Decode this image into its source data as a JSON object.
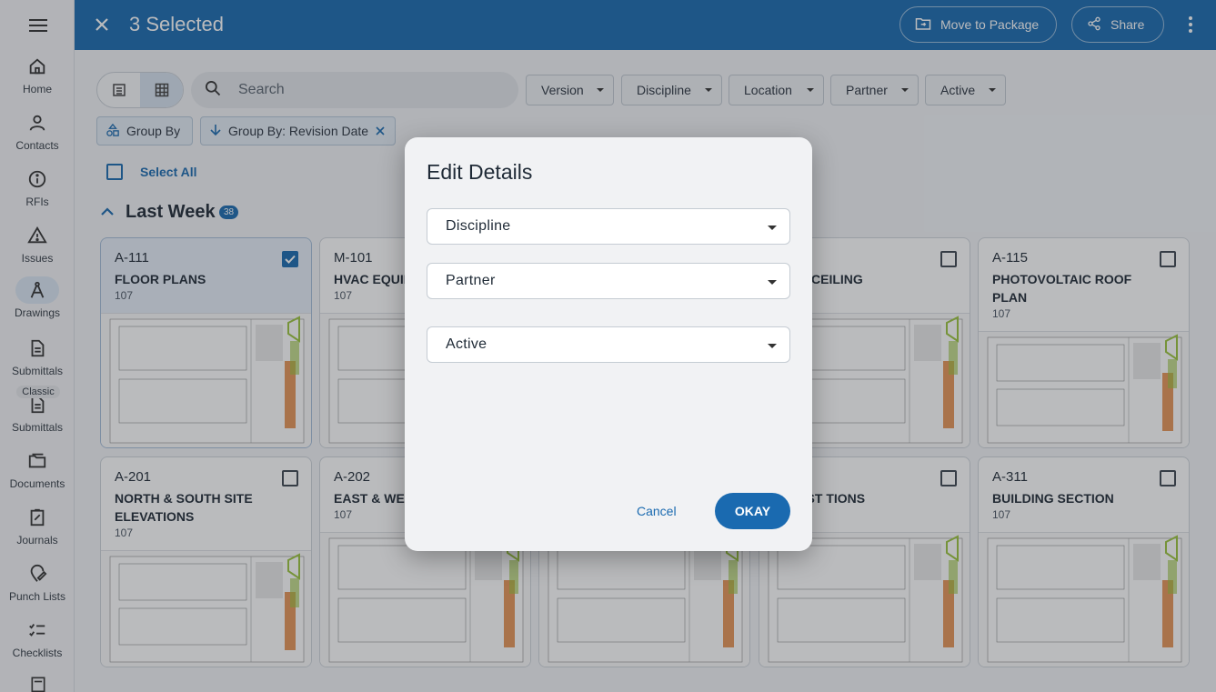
{
  "sidebar": {
    "items": [
      {
        "label": "Home",
        "icon": "home-icon"
      },
      {
        "label": "Contacts",
        "icon": "person-icon"
      },
      {
        "label": "RFIs",
        "icon": "info-icon"
      },
      {
        "label": "Issues",
        "icon": "warning-icon"
      },
      {
        "label": "Drawings",
        "icon": "compass-icon"
      },
      {
        "label": "Submittals",
        "icon": "document-icon"
      },
      {
        "label": "Submittals",
        "icon": "document-icon"
      },
      {
        "label": "Documents",
        "icon": "folder-icon"
      },
      {
        "label": "Journals",
        "icon": "edit-note-icon"
      },
      {
        "label": "Punch Lists",
        "icon": "pin-edit-icon"
      },
      {
        "label": "Checklists",
        "icon": "checklist-icon"
      }
    ],
    "classic_badge": "Classic"
  },
  "header": {
    "title": "3 Selected",
    "move_label": "Move to Package",
    "share_label": "Share"
  },
  "toolbar": {
    "search_placeholder": "Search",
    "filters": [
      "Version",
      "Discipline",
      "Location",
      "Partner",
      "Active"
    ],
    "group_by": "Group By",
    "group_by_chip": "Group By: Revision Date",
    "select_all": "Select All"
  },
  "group": {
    "title": "Last Week",
    "count": "38"
  },
  "cards": [
    {
      "number": "A-111",
      "name": "FLOOR PLANS",
      "rev": "107",
      "selected": true
    },
    {
      "number": "M-101",
      "name": "HVAC EQUIP",
      "rev": "107",
      "selected": false
    },
    {
      "number": "",
      "name": "",
      "rev": "",
      "selected": false
    },
    {
      "number": "",
      "name": "CTED CEILING",
      "rev": "",
      "selected": false
    },
    {
      "number": "A-115",
      "name": "PHOTOVOLTAIC ROOF PLAN",
      "rev": "107",
      "selected": false
    },
    {
      "number": "A-201",
      "name": "NORTH & SOUTH SITE ELEVATIONS",
      "rev": "107",
      "selected": false
    },
    {
      "number": "A-202",
      "name": "EAST & WES ELEVATION",
      "rev": "107",
      "selected": false
    },
    {
      "number": "",
      "name": "",
      "rev": "",
      "selected": false
    },
    {
      "number": "",
      "name": "& WEST TIONS",
      "rev": "",
      "selected": false
    },
    {
      "number": "A-311",
      "name": "BUILDING SECTION",
      "rev": "107",
      "selected": false
    }
  ],
  "dialog": {
    "title": "Edit Details",
    "fields": [
      "Discipline",
      "Partner",
      "Active"
    ],
    "cancel_label": "Cancel",
    "ok_label": "OKAY"
  },
  "colors": {
    "primary": "#1a6ab0",
    "accent_green": "#9bc53d",
    "accent_orange": "#e07a2e"
  }
}
